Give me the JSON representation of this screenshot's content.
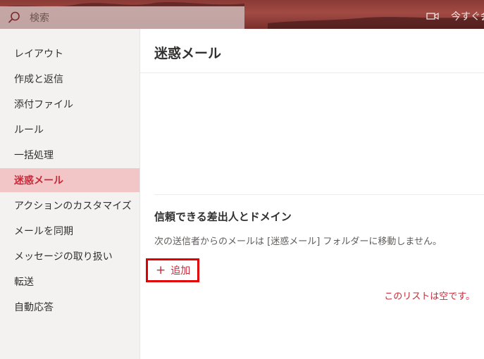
{
  "header": {
    "search_placeholder": "検索",
    "meet_now": "今すぐ会",
    "icons": [
      "search-icon",
      "video-icon"
    ]
  },
  "sidebar": {
    "items": [
      {
        "label": "レイアウト",
        "active": false
      },
      {
        "label": "作成と返信",
        "active": false
      },
      {
        "label": "添付ファイル",
        "active": false
      },
      {
        "label": "ルール",
        "active": false
      },
      {
        "label": "一括処理",
        "active": false
      },
      {
        "label": "迷惑メール",
        "active": true
      },
      {
        "label": "アクションのカスタマイズ",
        "active": false
      },
      {
        "label": "メールを同期",
        "active": false
      },
      {
        "label": "メッセージの取り扱い",
        "active": false
      },
      {
        "label": "転送",
        "active": false
      },
      {
        "label": "自動応答",
        "active": false
      }
    ]
  },
  "main": {
    "title": "迷惑メール",
    "section_title": "信頼できる差出人とドメイン",
    "description": "次の送信者からのメールは [迷惑メール] フォルダーに移動しません。",
    "add_label": "追加",
    "empty_message": "このリストは空です。"
  },
  "colors": {
    "accent": "#c42b3a",
    "active_bg": "#f2c5c7",
    "highlight_border": "#e00000"
  }
}
